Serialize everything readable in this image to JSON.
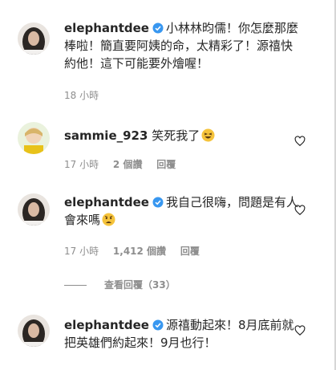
{
  "comments": [
    {
      "username": "elephantdee",
      "verified": true,
      "text": "小林林昀儒！你怎麼那麼棒啦！簡直要阿姨的命，太精彩了！源禧快約他！這下可能要外燴喔！",
      "time": "18 小時"
    },
    {
      "username": "sammie_923",
      "verified": false,
      "text": "笑死我了",
      "emoji": "laughing-emoji",
      "time": "17 小時",
      "replies": "2 個讚",
      "reply_label": "回覆"
    },
    {
      "username": "elephantdee",
      "verified": true,
      "text": "我自己很嗨，問題是有人會來嗎",
      "emoji": "fearful-emoji",
      "time": "17 小時",
      "likes": "1,412 個讚",
      "reply_label": "回覆"
    },
    {
      "username": "elephantdee",
      "verified": true,
      "text": "源禧動起來！8月底前就把英雄們約起來！9月也行！"
    }
  ],
  "view_replies": "查看回覆（33）",
  "colors": {
    "text": "#262626",
    "meta": "#8e8e8e",
    "verified": "#3897f0"
  },
  "icons": {
    "verified": "verified-badge-icon",
    "like": "heart-icon"
  }
}
